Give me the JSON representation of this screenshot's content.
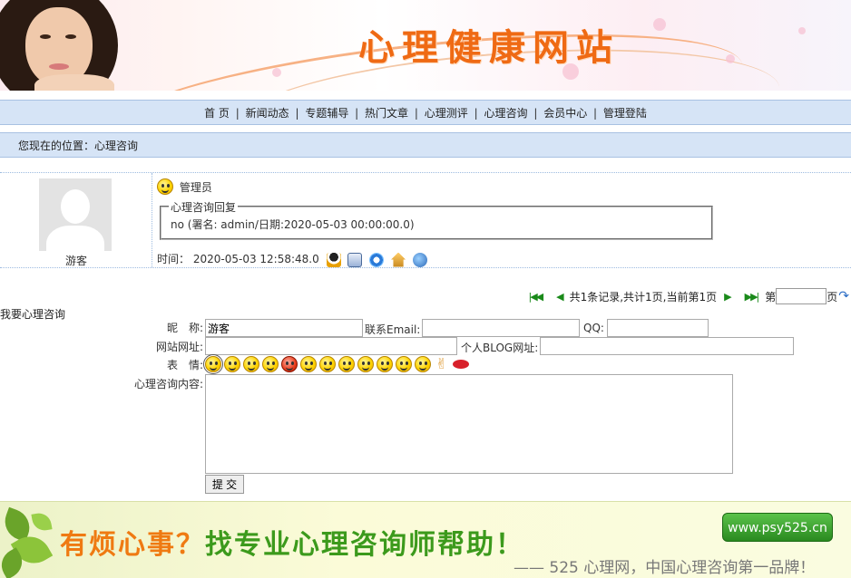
{
  "header": {
    "site_title": "心理健康网站"
  },
  "nav": {
    "items": [
      "首 页",
      "新闻动态",
      "专题辅导",
      "热门文章",
      "心理测评",
      "心理咨询",
      "会员中心",
      "管理登陆"
    ],
    "separator": "|"
  },
  "breadcrumb": {
    "text": "您现在的位置：心理咨询"
  },
  "entry": {
    "author": "游客",
    "reply_role": "管理员",
    "reply_legend": "心理咨询回复",
    "reply_text": "no (署名: admin/日期:2020-05-03 00:00:00.0)",
    "time_label": "时间：",
    "time_value": "2020-05-03 12:58:48.0"
  },
  "pager": {
    "summary": "共1条记录,共计1页,当前第1页",
    "page_prefix": "第",
    "page_suffix": "页",
    "page_input_value": ""
  },
  "form": {
    "title": "我要心理咨询",
    "nickname_label": "昵　称:",
    "nickname_value": "游客",
    "email_label": "联系Email:",
    "email_value": "",
    "qq_label": "QQ:",
    "qq_value": "",
    "website_label": "网站网址:",
    "website_value": "",
    "blog_label": "个人BLOG网址:",
    "blog_value": "",
    "emote_label": "表　情:",
    "content_label": "心理咨询内容:",
    "content_value": "",
    "submit_label": "提 交"
  },
  "footer": {
    "ad_part1": "有烦心事？",
    "ad_part2": "找专业心理咨询师帮助！",
    "ad_sub": "—— 525 心理网，中国心理咨询第一品牌！",
    "ad_url": "www.psy525.cn"
  },
  "icons": {
    "entry_meta": [
      "qq-icon",
      "message-icon",
      "ie-icon",
      "home-icon",
      "network-icon"
    ],
    "pager": [
      "first-page-icon",
      "prev-page-icon",
      "next-page-icon",
      "last-page-icon",
      "go-icon"
    ]
  },
  "colors": {
    "accent": "#ef6a14",
    "nav_bg": "#d6e4f6",
    "nav_border": "#a8c1e2"
  }
}
